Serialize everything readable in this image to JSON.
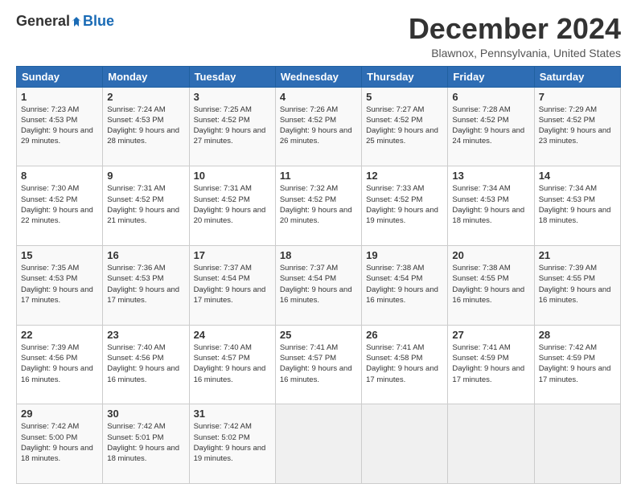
{
  "logo": {
    "general": "General",
    "blue": "Blue"
  },
  "title": "December 2024",
  "location": "Blawnox, Pennsylvania, United States",
  "days_of_week": [
    "Sunday",
    "Monday",
    "Tuesday",
    "Wednesday",
    "Thursday",
    "Friday",
    "Saturday"
  ],
  "weeks": [
    [
      {
        "day": "1",
        "sunrise": "Sunrise: 7:23 AM",
        "sunset": "Sunset: 4:53 PM",
        "daylight": "Daylight: 9 hours and 29 minutes."
      },
      {
        "day": "2",
        "sunrise": "Sunrise: 7:24 AM",
        "sunset": "Sunset: 4:53 PM",
        "daylight": "Daylight: 9 hours and 28 minutes."
      },
      {
        "day": "3",
        "sunrise": "Sunrise: 7:25 AM",
        "sunset": "Sunset: 4:52 PM",
        "daylight": "Daylight: 9 hours and 27 minutes."
      },
      {
        "day": "4",
        "sunrise": "Sunrise: 7:26 AM",
        "sunset": "Sunset: 4:52 PM",
        "daylight": "Daylight: 9 hours and 26 minutes."
      },
      {
        "day": "5",
        "sunrise": "Sunrise: 7:27 AM",
        "sunset": "Sunset: 4:52 PM",
        "daylight": "Daylight: 9 hours and 25 minutes."
      },
      {
        "day": "6",
        "sunrise": "Sunrise: 7:28 AM",
        "sunset": "Sunset: 4:52 PM",
        "daylight": "Daylight: 9 hours and 24 minutes."
      },
      {
        "day": "7",
        "sunrise": "Sunrise: 7:29 AM",
        "sunset": "Sunset: 4:52 PM",
        "daylight": "Daylight: 9 hours and 23 minutes."
      }
    ],
    [
      {
        "day": "8",
        "sunrise": "Sunrise: 7:30 AM",
        "sunset": "Sunset: 4:52 PM",
        "daylight": "Daylight: 9 hours and 22 minutes."
      },
      {
        "day": "9",
        "sunrise": "Sunrise: 7:31 AM",
        "sunset": "Sunset: 4:52 PM",
        "daylight": "Daylight: 9 hours and 21 minutes."
      },
      {
        "day": "10",
        "sunrise": "Sunrise: 7:31 AM",
        "sunset": "Sunset: 4:52 PM",
        "daylight": "Daylight: 9 hours and 20 minutes."
      },
      {
        "day": "11",
        "sunrise": "Sunrise: 7:32 AM",
        "sunset": "Sunset: 4:52 PM",
        "daylight": "Daylight: 9 hours and 20 minutes."
      },
      {
        "day": "12",
        "sunrise": "Sunrise: 7:33 AM",
        "sunset": "Sunset: 4:52 PM",
        "daylight": "Daylight: 9 hours and 19 minutes."
      },
      {
        "day": "13",
        "sunrise": "Sunrise: 7:34 AM",
        "sunset": "Sunset: 4:53 PM",
        "daylight": "Daylight: 9 hours and 18 minutes."
      },
      {
        "day": "14",
        "sunrise": "Sunrise: 7:34 AM",
        "sunset": "Sunset: 4:53 PM",
        "daylight": "Daylight: 9 hours and 18 minutes."
      }
    ],
    [
      {
        "day": "15",
        "sunrise": "Sunrise: 7:35 AM",
        "sunset": "Sunset: 4:53 PM",
        "daylight": "Daylight: 9 hours and 17 minutes."
      },
      {
        "day": "16",
        "sunrise": "Sunrise: 7:36 AM",
        "sunset": "Sunset: 4:53 PM",
        "daylight": "Daylight: 9 hours and 17 minutes."
      },
      {
        "day": "17",
        "sunrise": "Sunrise: 7:37 AM",
        "sunset": "Sunset: 4:54 PM",
        "daylight": "Daylight: 9 hours and 17 minutes."
      },
      {
        "day": "18",
        "sunrise": "Sunrise: 7:37 AM",
        "sunset": "Sunset: 4:54 PM",
        "daylight": "Daylight: 9 hours and 16 minutes."
      },
      {
        "day": "19",
        "sunrise": "Sunrise: 7:38 AM",
        "sunset": "Sunset: 4:54 PM",
        "daylight": "Daylight: 9 hours and 16 minutes."
      },
      {
        "day": "20",
        "sunrise": "Sunrise: 7:38 AM",
        "sunset": "Sunset: 4:55 PM",
        "daylight": "Daylight: 9 hours and 16 minutes."
      },
      {
        "day": "21",
        "sunrise": "Sunrise: 7:39 AM",
        "sunset": "Sunset: 4:55 PM",
        "daylight": "Daylight: 9 hours and 16 minutes."
      }
    ],
    [
      {
        "day": "22",
        "sunrise": "Sunrise: 7:39 AM",
        "sunset": "Sunset: 4:56 PM",
        "daylight": "Daylight: 9 hours and 16 minutes."
      },
      {
        "day": "23",
        "sunrise": "Sunrise: 7:40 AM",
        "sunset": "Sunset: 4:56 PM",
        "daylight": "Daylight: 9 hours and 16 minutes."
      },
      {
        "day": "24",
        "sunrise": "Sunrise: 7:40 AM",
        "sunset": "Sunset: 4:57 PM",
        "daylight": "Daylight: 9 hours and 16 minutes."
      },
      {
        "day": "25",
        "sunrise": "Sunrise: 7:41 AM",
        "sunset": "Sunset: 4:57 PM",
        "daylight": "Daylight: 9 hours and 16 minutes."
      },
      {
        "day": "26",
        "sunrise": "Sunrise: 7:41 AM",
        "sunset": "Sunset: 4:58 PM",
        "daylight": "Daylight: 9 hours and 17 minutes."
      },
      {
        "day": "27",
        "sunrise": "Sunrise: 7:41 AM",
        "sunset": "Sunset: 4:59 PM",
        "daylight": "Daylight: 9 hours and 17 minutes."
      },
      {
        "day": "28",
        "sunrise": "Sunrise: 7:42 AM",
        "sunset": "Sunset: 4:59 PM",
        "daylight": "Daylight: 9 hours and 17 minutes."
      }
    ],
    [
      {
        "day": "29",
        "sunrise": "Sunrise: 7:42 AM",
        "sunset": "Sunset: 5:00 PM",
        "daylight": "Daylight: 9 hours and 18 minutes."
      },
      {
        "day": "30",
        "sunrise": "Sunrise: 7:42 AM",
        "sunset": "Sunset: 5:01 PM",
        "daylight": "Daylight: 9 hours and 18 minutes."
      },
      {
        "day": "31",
        "sunrise": "Sunrise: 7:42 AM",
        "sunset": "Sunset: 5:02 PM",
        "daylight": "Daylight: 9 hours and 19 minutes."
      },
      null,
      null,
      null,
      null
    ]
  ]
}
